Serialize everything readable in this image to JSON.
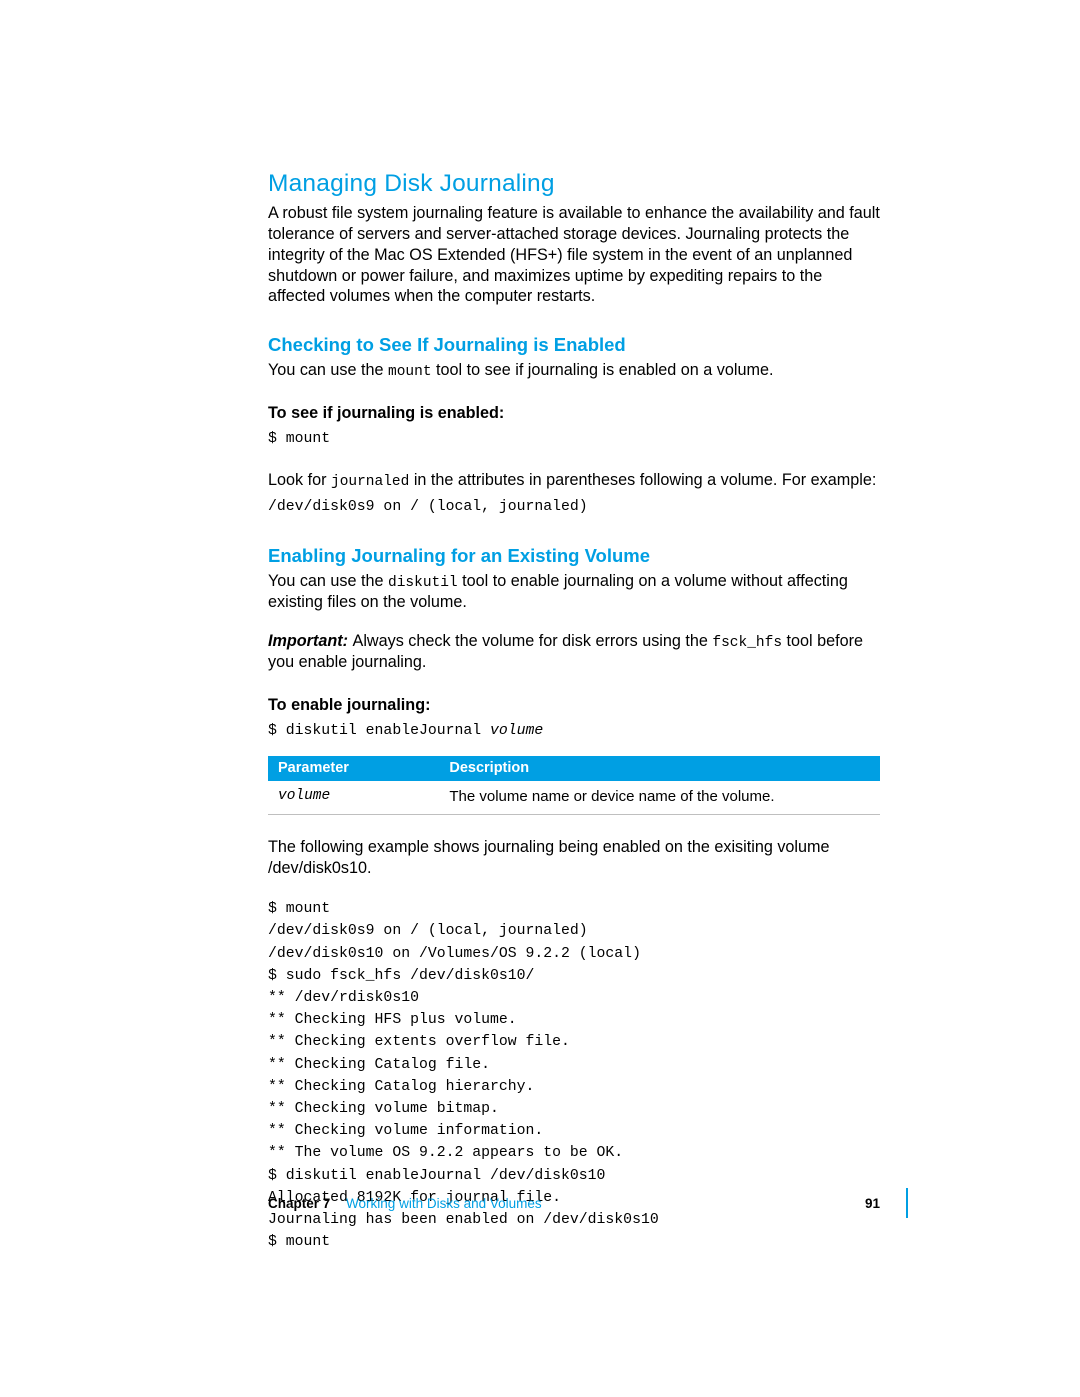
{
  "h1": "Managing Disk Journaling",
  "intro": "A robust file system journaling feature is available to enhance the availability and fault tolerance of servers and server-attached storage devices. Journaling protects the integrity of the Mac OS Extended (HFS+) file system in the event of an unplanned shutdown or power failure, and maximizes uptime by expediting repairs to the affected volumes when the computer restarts.",
  "sec1": {
    "title": "Checking to See If Journaling is Enabled",
    "lead_a": "You can use the ",
    "lead_code": "mount",
    "lead_b": " tool to see if journaling is enabled on a volume.",
    "step_title": "To see if journaling is enabled:",
    "cmd1": "$ mount",
    "look_a": "Look for ",
    "look_code": "journaled",
    "look_b": " in the attributes in parentheses following a volume. For example:",
    "example1": "/dev/disk0s9 on / (local, journaled)"
  },
  "sec2": {
    "title": "Enabling Journaling for an Existing Volume",
    "lead_a": "You can use the ",
    "lead_code": "diskutil",
    "lead_b": " tool to enable journaling on a volume without affecting existing files on the volume.",
    "imp_label": "Important:  ",
    "imp_a": "Always check the volume for disk errors using the ",
    "imp_code": "fsck_hfs",
    "imp_b": " tool before you enable journaling.",
    "step_title": "To enable journaling:",
    "cmd_a": "$ diskutil enableJournal ",
    "cmd_arg": "volume",
    "table": {
      "h1": "Parameter",
      "h2": "Description",
      "r1c1": "volume",
      "r1c2": "The volume name or device name of the volume."
    },
    "after_table": "The following example shows journaling being enabled on the exisiting volume /dev/disk0s10.",
    "example": "$ mount\n/dev/disk0s9 on / (local, journaled)\n/dev/disk0s10 on /Volumes/OS 9.2.2 (local)\n$ sudo fsck_hfs /dev/disk0s10/\n** /dev/rdisk0s10\n** Checking HFS plus volume.\n** Checking extents overflow file.\n** Checking Catalog file.\n** Checking Catalog hierarchy.\n** Checking volume bitmap.\n** Checking volume information.\n** The volume OS 9.2.2 appears to be OK.\n$ diskutil enableJournal /dev/disk0s10\nAllocated 8192K for journal file.\nJournaling has been enabled on /dev/disk0s10\n$ mount"
  },
  "footer": {
    "chapter_label": "Chapter 7",
    "chapter_name": "Working with Disks and Volumes",
    "page": "91"
  }
}
